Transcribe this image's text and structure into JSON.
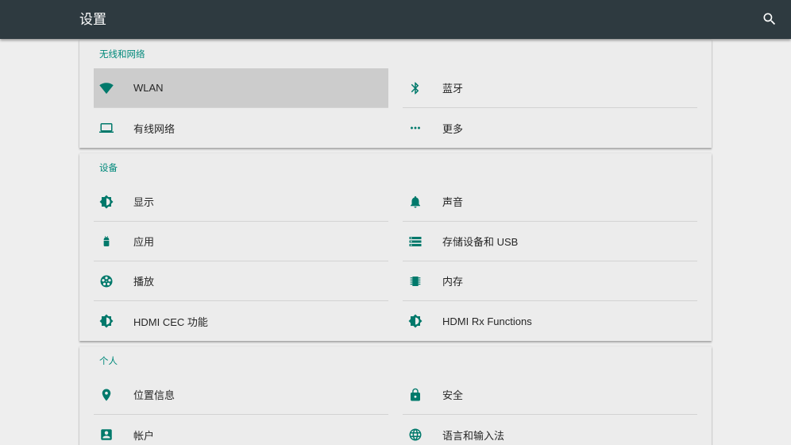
{
  "app_bar": {
    "title": "设置",
    "search_icon": "search-icon"
  },
  "colors": {
    "app_bar": "#2e3a40",
    "accent": "#00897b",
    "icon": "#00796b",
    "selected_row": "#cccccc",
    "background": "#eeeeee"
  },
  "sections": [
    {
      "header": "无线和网络",
      "items": [
        {
          "label": "WLAN",
          "icon": "wifi-icon",
          "selected": true
        },
        {
          "label": "蓝牙",
          "icon": "bluetooth-icon"
        },
        {
          "label": "有线网络",
          "icon": "laptop-icon"
        },
        {
          "label": "更多",
          "icon": "more-horiz-icon"
        }
      ]
    },
    {
      "header": "设备",
      "items": [
        {
          "label": "显示",
          "icon": "brightness-icon"
        },
        {
          "label": "声音",
          "icon": "bell-icon"
        },
        {
          "label": "应用",
          "icon": "android-icon"
        },
        {
          "label": "存储设备和 USB",
          "icon": "storage-icon"
        },
        {
          "label": "播放",
          "icon": "film-reel-icon"
        },
        {
          "label": "内存",
          "icon": "memory-chip-icon"
        },
        {
          "label": "HDMI CEC 功能",
          "icon": "brightness-icon"
        },
        {
          "label": "HDMI Rx Functions",
          "icon": "brightness-icon"
        }
      ]
    },
    {
      "header": "个人",
      "items": [
        {
          "label": "位置信息",
          "icon": "location-pin-icon"
        },
        {
          "label": "安全",
          "icon": "lock-icon"
        },
        {
          "label": "帐户",
          "icon": "account-box-icon"
        },
        {
          "label": "语言和输入法",
          "icon": "globe-icon"
        }
      ]
    }
  ]
}
